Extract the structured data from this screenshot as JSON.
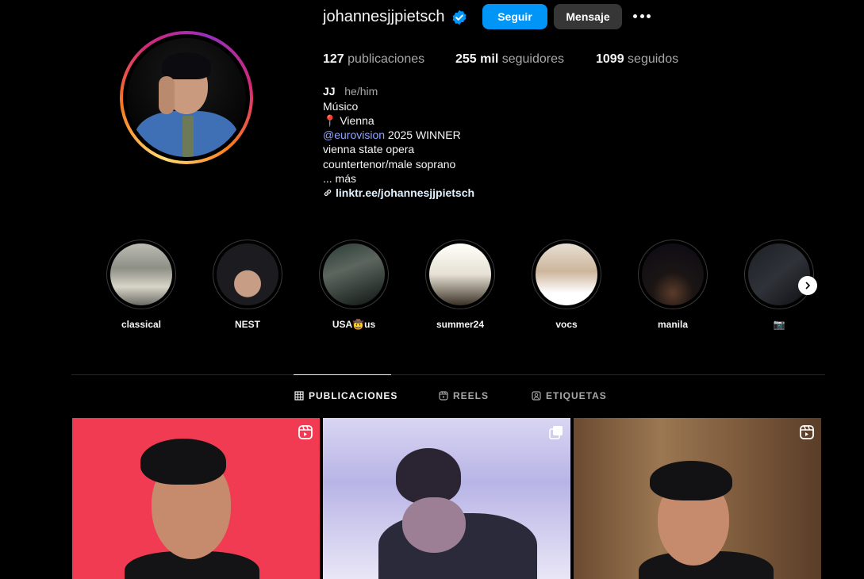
{
  "profile": {
    "username": "johannesjjpietsch",
    "follow_label": "Seguir",
    "message_label": "Mensaje",
    "posts_count": "127",
    "posts_label": "publicaciones",
    "followers_count": "255 mil",
    "followers_label": "seguidores",
    "following_count": "1099",
    "following_label": "seguidos"
  },
  "bio": {
    "name": "JJ",
    "pronouns": "he/him",
    "category": "Músico",
    "location": "📍 Vienna",
    "mention": "@eurovision",
    "mention_suffix": " 2025 WINNER",
    "line_opera": "vienna state opera",
    "line_voice": "countertenor/male soprano",
    "more": "... más",
    "link": "linktr.ee/johannesjjpietsch"
  },
  "highlights": [
    {
      "label": "classical"
    },
    {
      "label": "NEST"
    },
    {
      "label": "USA🤠us"
    },
    {
      "label": "summer24"
    },
    {
      "label": "vocs"
    },
    {
      "label": "manila"
    },
    {
      "label": "📷"
    }
  ],
  "tabs": {
    "posts": "PUBLICACIONES",
    "reels": "REELS",
    "tagged": "ETIQUETAS"
  },
  "colors": {
    "accent": "#0095f6",
    "background": "#000000"
  }
}
